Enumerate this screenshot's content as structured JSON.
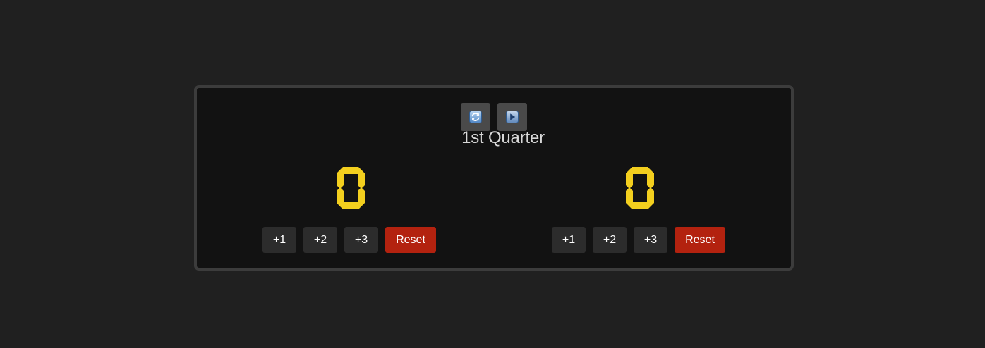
{
  "quarter_label": "1st Quarter",
  "controls": {
    "refresh_icon": "refresh-icon",
    "play_icon": "play-icon"
  },
  "teams": [
    {
      "score_digit": "0",
      "buttons": {
        "plus1": "+1",
        "plus2": "+2",
        "plus3": "+3",
        "reset": "Reset"
      }
    },
    {
      "score_digit": "0",
      "buttons": {
        "plus1": "+1",
        "plus2": "+2",
        "plus3": "+3",
        "reset": "Reset"
      }
    }
  ],
  "colors": {
    "page_background": "#202020",
    "board_background": "#121212",
    "board_border": "#3c3c3c",
    "digit": "#f3cf1e",
    "score_button": "#2c2c2c",
    "reset_button": "#b3220f"
  }
}
